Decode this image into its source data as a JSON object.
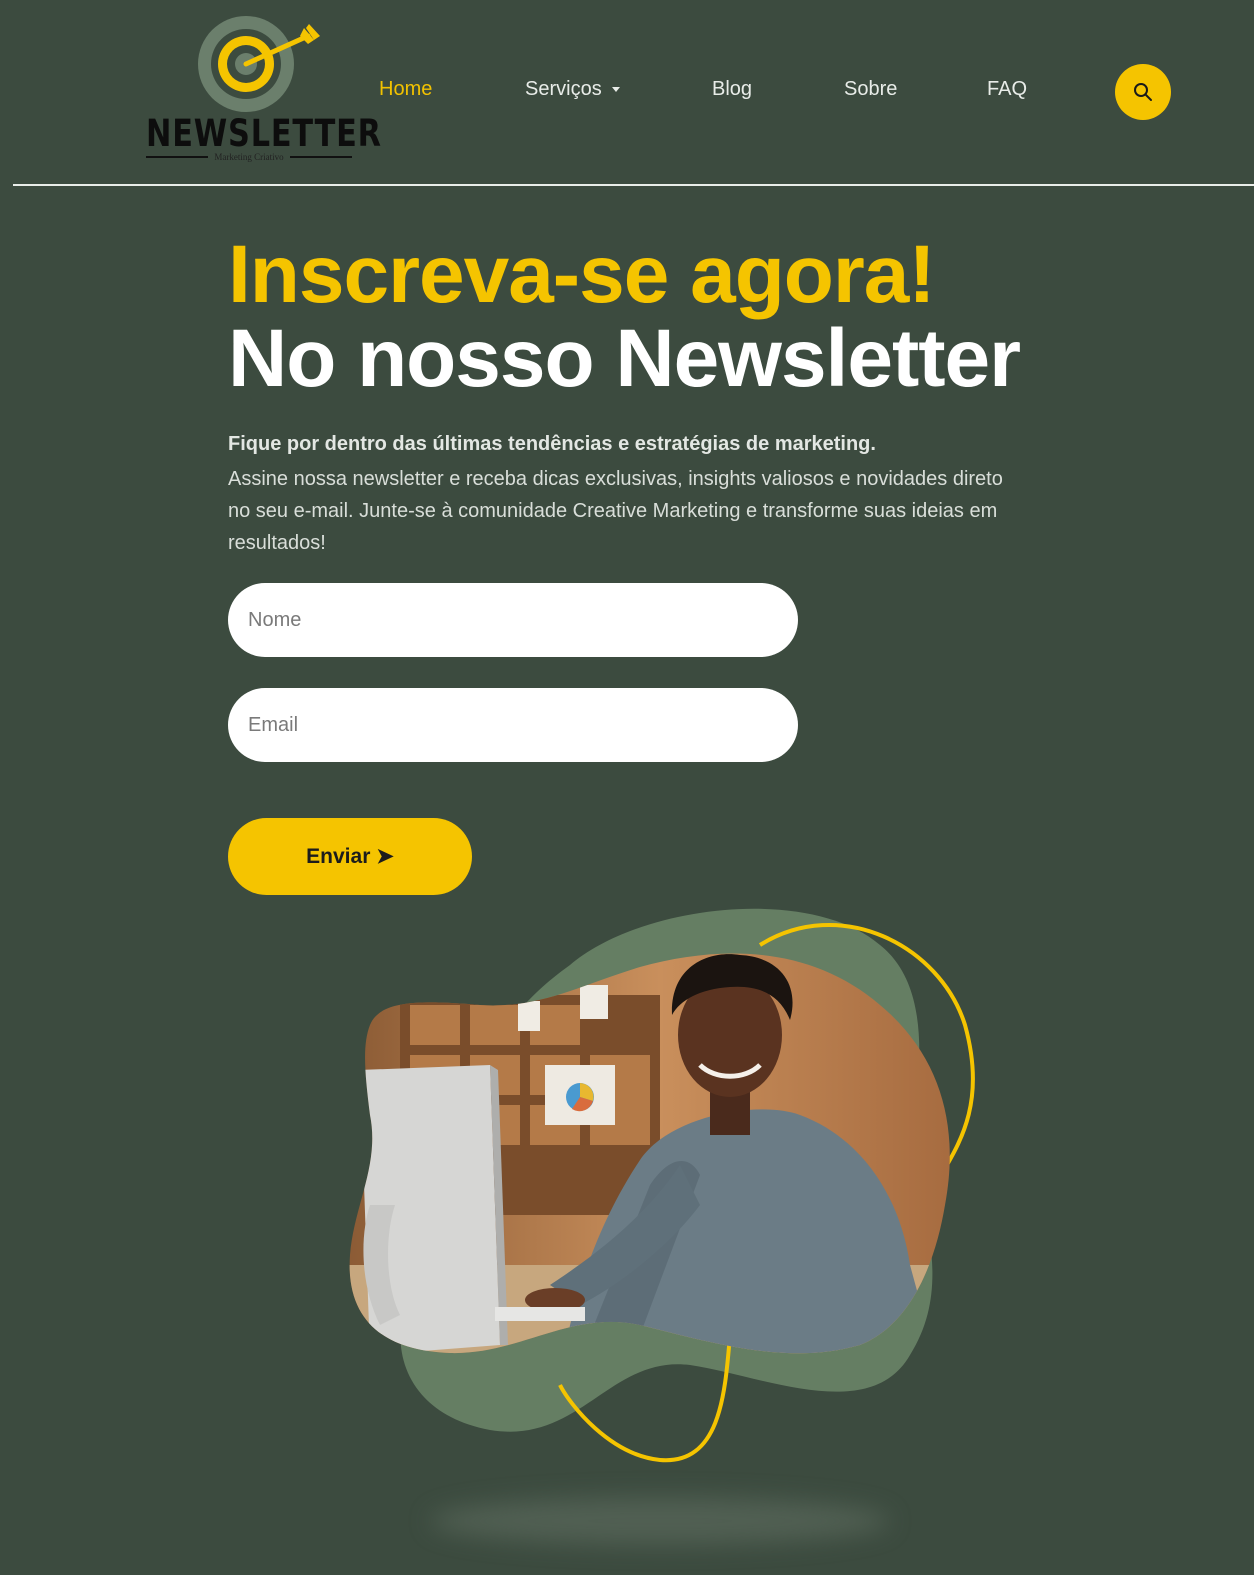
{
  "brand": {
    "name": "NEWSLETTER",
    "tagline": "Marketing Criativo"
  },
  "nav": {
    "items": [
      {
        "label": "Home",
        "active": true
      },
      {
        "label": "Serviços",
        "has_dropdown": true
      },
      {
        "label": "Blog"
      },
      {
        "label": "Sobre"
      },
      {
        "label": "FAQ"
      }
    ],
    "search_icon": "search-icon"
  },
  "hero": {
    "title_line1": "Inscreva-se agora!",
    "title_line2": "No nosso Newsletter",
    "lead": "Fique por dentro das últimas tendências e estratégias de marketing.",
    "description": "Assine nossa newsletter e receba dicas exclusivas, insights valiosos e novidades direto no seu e-mail. Junte-se à comunidade Creative Marketing e transforme suas ideias em resultados!"
  },
  "form": {
    "name_placeholder": "Nome",
    "email_placeholder": "Email",
    "submit_label": "Enviar ➤"
  },
  "colors": {
    "background": "#3c4b3f",
    "accent": "#f5c400",
    "blob": "#657e63",
    "text": "#ffffff"
  }
}
